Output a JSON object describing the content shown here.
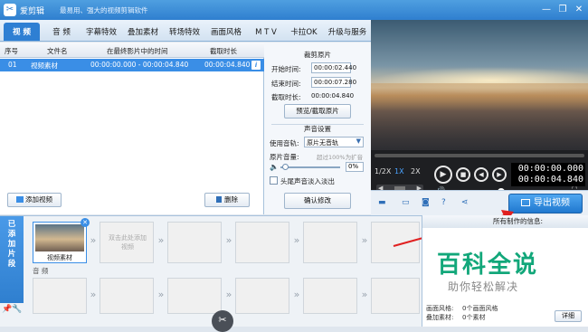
{
  "titlebar": {
    "logo_glyph": "✂",
    "app_name": "爱剪辑",
    "slogan": "最易用、强大的视频剪辑软件",
    "min_glyph": "—",
    "max_glyph": "❐",
    "close_glyph": "✕"
  },
  "tabs": [
    "视 频",
    "音 频",
    "字幕特效",
    "叠加素材",
    "转场特效",
    "画面风格",
    "M T V",
    "卡拉OK",
    "升级与服务"
  ],
  "cliplist": {
    "headers": [
      "序号",
      "文件名",
      "在最终影片中的时间",
      "截取时长"
    ],
    "rows": [
      {
        "index": "01",
        "name": "视频素材",
        "range": "00:00:00.000 - 00:00:04.840",
        "duration": "00:00:04.840",
        "info": "i"
      }
    ],
    "add_label": "添加视频",
    "delete_label": "删除"
  },
  "crop": {
    "title": "裁剪原片",
    "start_label": "开始时间:",
    "start_value": "00:00:02.440",
    "end_label": "结束时间:",
    "end_value": "00:00:07.280",
    "duration_label": "截取时长:",
    "duration_value": "00:00:04.840",
    "preview_button": "预览/截取原片",
    "audio_title": "声音设置",
    "track_label": "使用音轨:",
    "track_value": "原片无音轨",
    "volume_label": "原片音量:",
    "volume_hint": "超过100%为扩音",
    "volume_value": "0%",
    "fade_label": "头尾声音淡入淡出",
    "confirm_button": "确认修改"
  },
  "player": {
    "speeds": [
      "1/2X",
      "1X",
      "2X"
    ],
    "time_current": "00:00:00.000",
    "time_total": "00:00:04.840",
    "progress": 0
  },
  "export": {
    "label": "导出视频"
  },
  "timeline": {
    "side_label": "已添加片段",
    "clip_label": "视频素材",
    "placeholder": "双击此处添加视频",
    "audio_label": "音 频"
  },
  "info": {
    "title": "所有制作的信息:",
    "watermark_main": "百科全说",
    "watermark_sub": "助你轻松解决",
    "row1_label": "画面风格:",
    "row1_value": "0个画面风格",
    "row2_label": "叠加素材:",
    "row2_value": "0个素材",
    "detail_button": "详细"
  },
  "colors": {
    "accent": "#2e7fd3",
    "watermark": "#12a77a"
  }
}
